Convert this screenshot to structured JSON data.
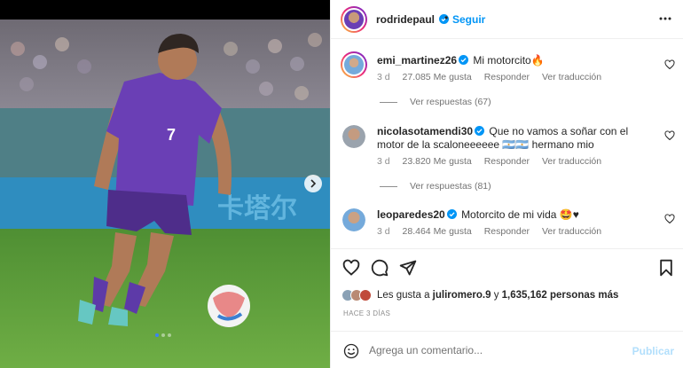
{
  "post": {
    "author": "rodridepaul",
    "follow_label": "Seguir",
    "separator": "•",
    "media_page_count": 3
  },
  "comments": [
    {
      "username": "emi_martinez26",
      "text": "Mi motorcito🔥",
      "time": "3 d",
      "likes": "27.085 Me gusta",
      "reply_label": "Responder",
      "translate_label": "Ver traducción",
      "replies_label": "Ver respuestas (67)"
    },
    {
      "username": "nicolasotamendi30",
      "text": "Que no vamos a soñar con el motor de la scaloneeeeee 🇦🇷🇦🇷 hermano mio",
      "time": "3 d",
      "likes": "23.820 Me gusta",
      "reply_label": "Responder",
      "translate_label": "Ver traducción",
      "replies_label": "Ver respuestas (81)"
    },
    {
      "username": "leoparedes20",
      "text": "Motorcito de mi vida 🤩♥",
      "time": "3 d",
      "likes": "28.464 Me gusta",
      "reply_label": "Responder",
      "translate_label": "Ver traducción"
    }
  ],
  "likes_summary": {
    "prefix": "Les gusta a",
    "first_user": "juliromero.9",
    "connector": "y",
    "others": "1,635,162 personas más"
  },
  "time_ago": "HACE 3 DÍAS",
  "composer": {
    "placeholder": "Agrega un comentario...",
    "post_label": "Publicar"
  },
  "icons": {
    "more": "more-horizontal-icon",
    "heart": "heart-outline-icon",
    "comment": "comment-bubble-icon",
    "share": "paper-plane-icon",
    "save": "bookmark-icon",
    "emoji": "smiley-icon",
    "next": "chevron-right-icon",
    "verified": "verified-badge-icon"
  },
  "colors": {
    "link_blue": "#0095f6",
    "post_disabled": "#b2dffc",
    "muted_text": "#8e8e8e",
    "jersey_purple": "#6a3fb5",
    "pitch_green": "#5b9a3a"
  }
}
